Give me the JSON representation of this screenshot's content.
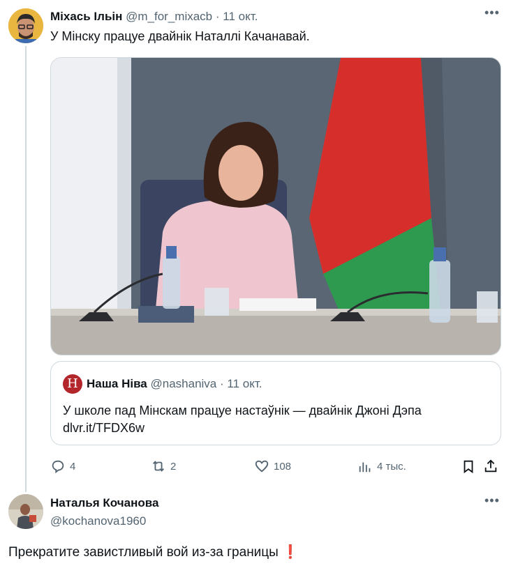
{
  "tweet": {
    "author_name": "Міхась Ільін",
    "handle": "@m_for_mixacb",
    "separator": "·",
    "date": "11 окт.",
    "text": "У Мінску працуе двайнік Наталлі Качанавай.",
    "more_icon": "more-dots-icon",
    "quote": {
      "author_name": "Наша Ніва",
      "handle": "@nashaniva",
      "separator": "·",
      "date": "11 окт.",
      "logo_letter": "Н",
      "text_line1": "У школе пад Мінскам працуе настаўнік — двайнік Джоні Дэпа",
      "link": "dlvr.it/TFDX6w"
    },
    "actions": {
      "replies": "4",
      "reposts": "2",
      "likes": "108",
      "views": "4 тыс.",
      "icons": [
        "reply-icon",
        "repost-icon",
        "like-icon",
        "views-icon",
        "bookmark-icon",
        "share-icon"
      ]
    }
  },
  "reply": {
    "author_name": "Наталья Кочанова",
    "handle": "@kochanova1960",
    "text": "Прекратите завистливый вой из-за границы",
    "emoji": "❗"
  },
  "colors": {
    "text": "#0f1419",
    "muted": "#536471",
    "border": "#cfd9de",
    "flag_red": "#d62f2b",
    "flag_green": "#2e9a4f",
    "news_brand": "#b3262b"
  }
}
